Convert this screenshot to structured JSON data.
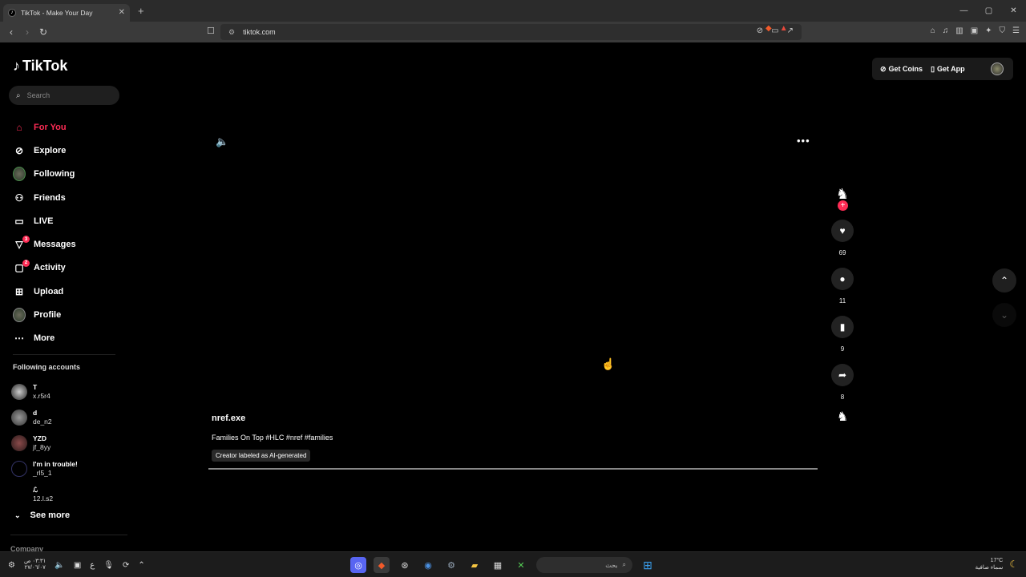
{
  "browser": {
    "tab_title": "TikTok - Make Your Day",
    "url": "tiktok.com",
    "new_tab": "+",
    "window_controls": {
      "minimize": "—",
      "maximize": "▢",
      "close": "✕"
    }
  },
  "app": {
    "logo_text": "TikTok",
    "search_placeholder": "Search",
    "nav": [
      {
        "label": "For You",
        "icon": "home-icon",
        "active": true
      },
      {
        "label": "Explore",
        "icon": "compass-icon"
      },
      {
        "label": "Following",
        "icon": "following-avatar-icon"
      },
      {
        "label": "Friends",
        "icon": "friends-icon"
      },
      {
        "label": "LIVE",
        "icon": "live-icon"
      },
      {
        "label": "Messages",
        "icon": "messages-icon",
        "badge": "3"
      },
      {
        "label": "Activity",
        "icon": "activity-icon",
        "badge": "2"
      },
      {
        "label": "Upload",
        "icon": "upload-icon"
      },
      {
        "label": "Profile",
        "icon": "profile-avatar-icon"
      },
      {
        "label": "More",
        "icon": "more-icon"
      }
    ],
    "following_title": "Following accounts",
    "following_accounts": [
      {
        "name": "T",
        "username": "x.r5r4"
      },
      {
        "name": "d",
        "username": "de_n2"
      },
      {
        "name": "YZD",
        "username": "jf_8yy"
      },
      {
        "name": "I'm in trouble!",
        "username": "_rl5_1"
      },
      {
        "name": "ℒ",
        "username": "12.l.s2"
      }
    ],
    "see_more": "See more",
    "company": "Company",
    "get_coins": "Get Coins",
    "get_app": "Get App"
  },
  "video": {
    "author": "nref.exe",
    "caption": "Families On Top #HLC #nref #families",
    "ai_label": "Creator labeled as AI-generated",
    "progress": 1.0,
    "likes": "69",
    "comments": "11",
    "saves": "9",
    "shares": "8"
  },
  "taskbar": {
    "search_text": "بحث",
    "time": "٠٣:٣١ ص",
    "date": "٢٧/٠٦/٠٧",
    "lang": "ع",
    "weather_temp": "17°C",
    "weather_desc": "سماء صافية"
  },
  "colors": {
    "accent": "#fe2c55",
    "background": "#000000"
  }
}
